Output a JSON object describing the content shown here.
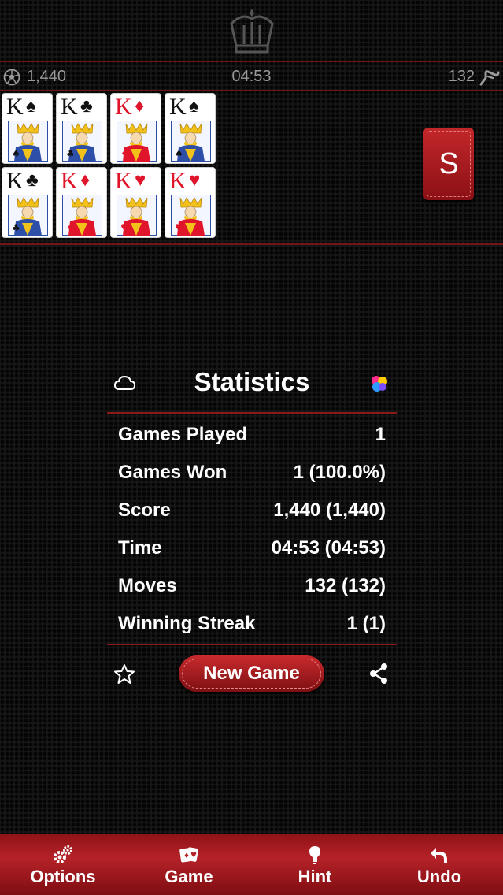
{
  "status": {
    "score": "1,440",
    "time": "04:53",
    "moves": "132"
  },
  "foundation_cards": [
    {
      "rank": "K",
      "suit": "♠",
      "color": "black"
    },
    {
      "rank": "K",
      "suit": "♣",
      "color": "black"
    },
    {
      "rank": "K",
      "suit": "♦",
      "color": "red"
    },
    {
      "rank": "K",
      "suit": "♠",
      "color": "black"
    },
    {
      "rank": "K",
      "suit": "♣",
      "color": "black"
    },
    {
      "rank": "K",
      "suit": "♦",
      "color": "red"
    },
    {
      "rank": "K",
      "suit": "♥",
      "color": "red"
    },
    {
      "rank": "K",
      "suit": "♥",
      "color": "red"
    }
  ],
  "stock": {
    "letter": "S"
  },
  "statistics": {
    "title": "Statistics",
    "rows": [
      {
        "label": "Games Played",
        "value": "1"
      },
      {
        "label": "Games Won",
        "value": "1 (100.0%)"
      },
      {
        "label": "Score",
        "value": "1,440 (1,440)"
      },
      {
        "label": "Time",
        "value": "04:53 (04:53)"
      },
      {
        "label": "Moves",
        "value": "132 (132)"
      },
      {
        "label": "Winning Streak",
        "value": "1 (1)"
      }
    ],
    "new_game_label": "New Game"
  },
  "toolbar": {
    "options_label": "Options",
    "game_label": "Game",
    "hint_label": "Hint",
    "undo_label": "Undo"
  },
  "icons": {
    "crown": "crown-icon",
    "score": "soccer-ball-icon",
    "moves": "hand-point-icon",
    "cloud": "cloud-icon",
    "game_center": "game-center-bubbles-icon",
    "star": "star-icon",
    "share": "share-icon",
    "options": "gears-icon",
    "game": "cards-icon",
    "hint": "lightbulb-icon",
    "undo": "undo-arrow-icon"
  },
  "colors": {
    "accent_red": "#b52228",
    "divider_red": "#6e1515",
    "background": "#171717"
  }
}
